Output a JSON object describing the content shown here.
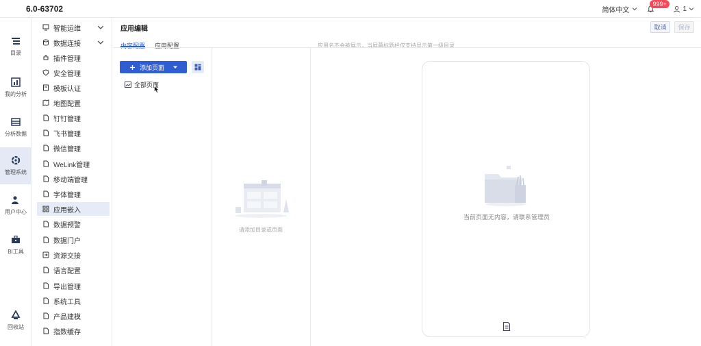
{
  "app": {
    "version": "6.0-63702"
  },
  "header": {
    "language": "简体中文",
    "notifications_badge": "999+",
    "user_count": "1"
  },
  "rail": {
    "items": [
      {
        "label": "目录",
        "icon": "list-icon"
      },
      {
        "label": "我的分析",
        "icon": "analysis-icon"
      },
      {
        "label": "分析数据",
        "icon": "table-icon"
      },
      {
        "label": "管理系统",
        "icon": "settings-icon",
        "active": true
      },
      {
        "label": "用户中心",
        "icon": "user-icon"
      },
      {
        "label": "BI工具",
        "icon": "toolbox-icon"
      },
      {
        "label": "回收站",
        "icon": "recycle-icon"
      }
    ]
  },
  "menu": {
    "items": [
      {
        "label": "智能运维",
        "icon": "monitor-icon",
        "has_children": true
      },
      {
        "label": "数据连接",
        "icon": "database-icon",
        "has_children": true
      },
      {
        "label": "插件管理",
        "icon": "plugin-icon"
      },
      {
        "label": "安全管理",
        "icon": "shield-icon"
      },
      {
        "label": "模板认证",
        "icon": "certificate-icon"
      },
      {
        "label": "地图配置",
        "icon": "map-icon"
      },
      {
        "label": "钉钉管理",
        "icon": "file-icon"
      },
      {
        "label": "飞书管理",
        "icon": "file-icon"
      },
      {
        "label": "微信管理",
        "icon": "file-icon"
      },
      {
        "label": "WeLink管理",
        "icon": "file-icon"
      },
      {
        "label": "移动端管理",
        "icon": "file-icon"
      },
      {
        "label": "字体管理",
        "icon": "file-icon"
      },
      {
        "label": "应用嵌入",
        "icon": "apps-icon",
        "active": true
      },
      {
        "label": "数据预警",
        "icon": "file-icon"
      },
      {
        "label": "数据门户",
        "icon": "file-icon"
      },
      {
        "label": "资源交接",
        "icon": "handover-icon"
      },
      {
        "label": "语言配置",
        "icon": "file-icon"
      },
      {
        "label": "导出管理",
        "icon": "file-icon"
      },
      {
        "label": "系统工具",
        "icon": "file-icon"
      },
      {
        "label": "产品建模",
        "icon": "file-icon"
      },
      {
        "label": "指数缓存",
        "icon": "file-icon"
      }
    ]
  },
  "main": {
    "title": "应用编辑",
    "cancel_label": "取消",
    "save_label": "保存",
    "tabs": [
      "内容配置",
      "应用配置"
    ],
    "notice": "应用名不会被展示，当屏幕标题栏仅支持显示第一级目录",
    "add_page_label": "添加页面",
    "page_node_label": "全部页面",
    "empty_middle_text": "请添加目录或页面",
    "phone_empty_text": "当前页面无内容，请联系管理员"
  }
}
